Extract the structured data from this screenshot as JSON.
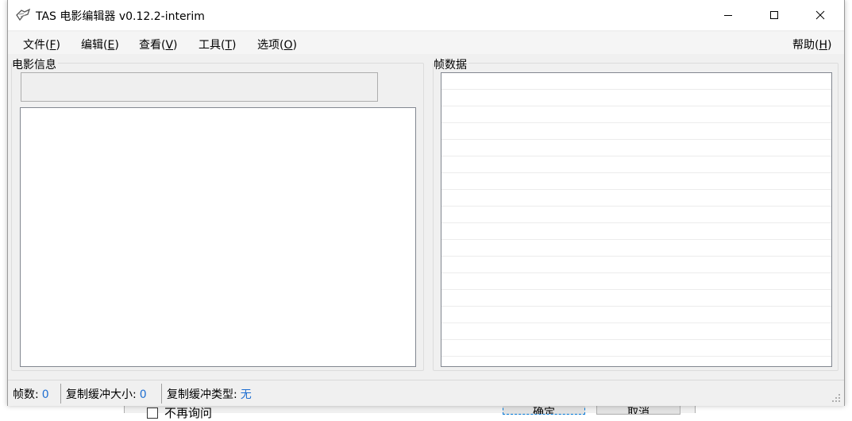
{
  "background_dialog": {
    "checkbox_label": "不再询问",
    "ok_label": "确定",
    "cancel_label": "取消"
  },
  "window": {
    "title": "TAS 电影编辑器 v0.12.2-interim",
    "icon": "app-icon"
  },
  "menu": {
    "file": {
      "text": "文件(",
      "key": "F",
      "end": ")"
    },
    "edit": {
      "text": "编辑(",
      "key": "E",
      "end": ")"
    },
    "view": {
      "text": "查看(",
      "key": "V",
      "end": ")"
    },
    "tools": {
      "text": "工具(",
      "key": "T",
      "end": ")"
    },
    "options": {
      "text": "选项(",
      "key": "O",
      "end": ")"
    },
    "help": {
      "text": "帮助(",
      "key": "H",
      "end": ")"
    }
  },
  "movie_info": {
    "label": "电影信息",
    "field_value": ""
  },
  "frame_data": {
    "label": "帧数据",
    "rows": 17
  },
  "status": {
    "frames_label": "帧数:",
    "frames_value": "0",
    "buffer_size_label": "复制缓冲大小:",
    "buffer_size_value": "0",
    "buffer_type_label": "复制缓冲类型:",
    "buffer_type_value": "无"
  },
  "colors": {
    "status_value": "#1f6fd1",
    "window_bg": "#f0f0f0"
  }
}
